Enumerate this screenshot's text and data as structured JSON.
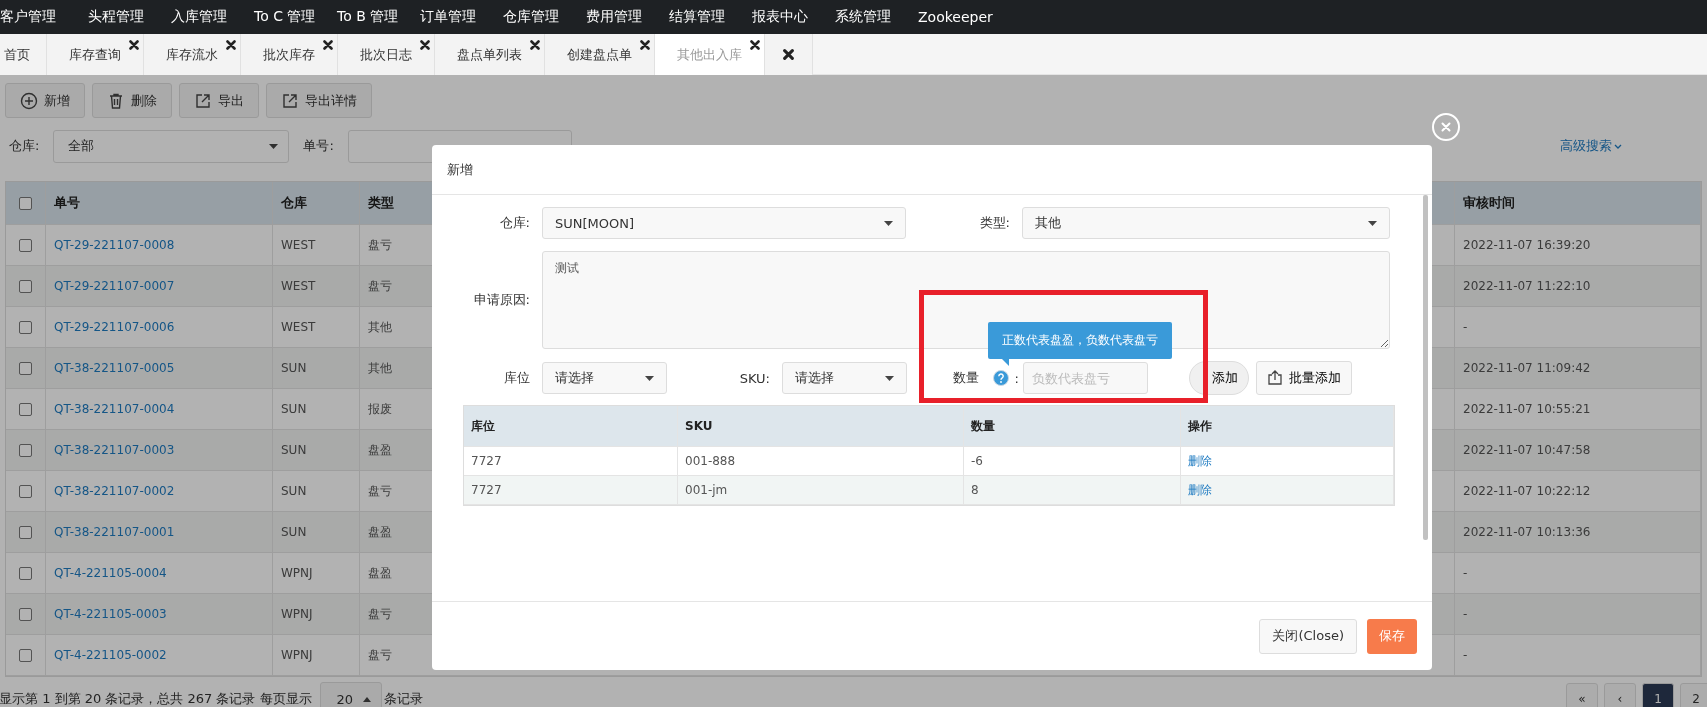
{
  "top_nav": {
    "items": [
      "客户管理",
      "头程管理",
      "入库管理",
      "To C 管理",
      "To B 管理",
      "订单管理",
      "仓库管理",
      "费用管理",
      "结算管理",
      "报表中心",
      "系统管理",
      "Zookeeper"
    ]
  },
  "tabs": [
    {
      "kind": "page",
      "label": "首页",
      "closable": false,
      "selected": false
    },
    {
      "kind": "page",
      "label": "库存查询",
      "closable": true,
      "selected": false
    },
    {
      "kind": "page",
      "label": "库存流水",
      "closable": true,
      "selected": false
    },
    {
      "kind": "page",
      "label": "批次库存",
      "closable": true,
      "selected": false
    },
    {
      "kind": "page",
      "label": "批次日志",
      "closable": true,
      "selected": false
    },
    {
      "kind": "page",
      "label": "盘点单列表",
      "closable": true,
      "selected": false
    },
    {
      "kind": "page",
      "label": "创建盘点单",
      "closable": true,
      "selected": false
    },
    {
      "kind": "page",
      "label": "其他出入库",
      "closable": true,
      "selected": true
    },
    {
      "kind": "close_all",
      "selected": false
    }
  ],
  "toolbar": {
    "buttons": [
      {
        "kind": "plus",
        "label": "新增"
      },
      {
        "kind": "trash",
        "label": "删除"
      },
      {
        "kind": "export",
        "label": "导出"
      },
      {
        "kind": "export",
        "label": "导出详情"
      }
    ]
  },
  "filters": {
    "warehouse_label": "仓库:",
    "warehouse_value": "全部",
    "order_no_label": "单号:",
    "advanced_search": "高级搜索"
  },
  "table": {
    "header_checked": false,
    "columns": [
      "单号",
      "仓库",
      "类型",
      "审核时间"
    ],
    "rows": [
      {
        "order_no": "QT-29-221107-0008",
        "warehouse": "WEST",
        "type": "盘亏",
        "audit_time": "2022-11-07 16:39:20",
        "checked": false
      },
      {
        "order_no": "QT-29-221107-0007",
        "warehouse": "WEST",
        "type": "盘亏",
        "audit_time": "2022-11-07 11:22:10",
        "checked": false
      },
      {
        "order_no": "QT-29-221107-0006",
        "warehouse": "WEST",
        "type": "其他",
        "audit_time": "-",
        "checked": false
      },
      {
        "order_no": "QT-38-221107-0005",
        "warehouse": "SUN",
        "type": "其他",
        "audit_time": "2022-11-07 11:09:42",
        "checked": false
      },
      {
        "order_no": "QT-38-221107-0004",
        "warehouse": "SUN",
        "type": "报废",
        "audit_time": "2022-11-07 10:55:21",
        "checked": false
      },
      {
        "order_no": "QT-38-221107-0003",
        "warehouse": "SUN",
        "type": "盘盈",
        "audit_time": "2022-11-07 10:47:58",
        "checked": false
      },
      {
        "order_no": "QT-38-221107-0002",
        "warehouse": "SUN",
        "type": "盘亏",
        "audit_time": "2022-11-07 10:22:12",
        "checked": false
      },
      {
        "order_no": "QT-38-221107-0001",
        "warehouse": "SUN",
        "type": "盘盈",
        "audit_time": "2022-11-07 10:13:36",
        "checked": false
      },
      {
        "order_no": "QT-4-221105-0004",
        "warehouse": "WPNJ",
        "type": "盘盈",
        "audit_time": "-",
        "checked": false
      },
      {
        "order_no": "QT-4-221105-0003",
        "warehouse": "WPNJ",
        "type": "盘亏",
        "audit_time": "-",
        "checked": false
      },
      {
        "order_no": "QT-4-221105-0002",
        "warehouse": "WPNJ",
        "type": "盘亏",
        "audit_time": "-",
        "checked": false
      }
    ]
  },
  "pagination": {
    "summary": "显示第 1 到第 20 条记录，总共 267 条记录 每页显示",
    "page_size": "20",
    "suffix": "条记录",
    "pages": [
      {
        "label": "«",
        "selected": false
      },
      {
        "label": "‹",
        "selected": false
      },
      {
        "label": "1",
        "selected": true
      },
      {
        "label": "2",
        "selected": false
      }
    ]
  },
  "modal": {
    "title": "新增",
    "warehouse_label": "仓库:",
    "warehouse_value": "SUN[MOON]",
    "type_label": "类型:",
    "type_value": "其他",
    "reason_label": "申请原因:",
    "reason_value": "测试",
    "location_label": "库位",
    "location_value": "请选择",
    "sku_label": "SKU:",
    "sku_value": "请选择",
    "qty_label": "数量",
    "qty_colon": ":",
    "qty_placeholder": "负数代表盘亏",
    "tooltip": "正数代表盘盈，负数代表盘亏",
    "add_button": "添加",
    "batch_add_button": "批量添加",
    "items_table": {
      "columns": [
        "库位",
        "SKU",
        "数量",
        "操作"
      ],
      "rows": [
        {
          "location": "7727",
          "sku": "001-888",
          "qty": "-6",
          "action": "删除"
        },
        {
          "location": "7727",
          "sku": "001-jm",
          "qty": "8",
          "action": "删除"
        }
      ]
    },
    "close_button": "关闭(Close)",
    "save_button": "保存"
  }
}
